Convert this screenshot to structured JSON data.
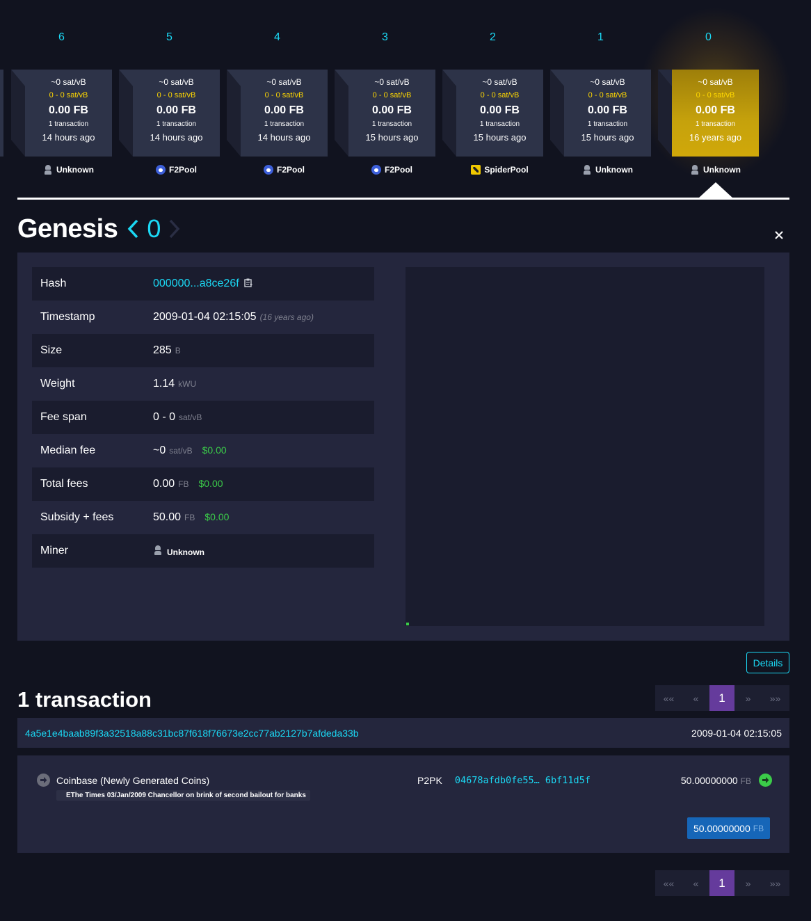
{
  "blocks": [
    {
      "height": "6",
      "median_fee": "~0 sat/vB",
      "fee_span": "0 - 0 sat/vB",
      "total_fees": "0.00 FB",
      "tx_count": "1 transaction",
      "time": "14 hours ago",
      "miner": "Unknown",
      "miner_icon": "unknown-miner-icon",
      "selected": false
    },
    {
      "height": "5",
      "median_fee": "~0 sat/vB",
      "fee_span": "0 - 0 sat/vB",
      "total_fees": "0.00 FB",
      "tx_count": "1 transaction",
      "time": "14 hours ago",
      "miner": "F2Pool",
      "miner_icon": "f2pool-icon",
      "selected": false
    },
    {
      "height": "4",
      "median_fee": "~0 sat/vB",
      "fee_span": "0 - 0 sat/vB",
      "total_fees": "0.00 FB",
      "tx_count": "1 transaction",
      "time": "14 hours ago",
      "miner": "F2Pool",
      "miner_icon": "f2pool-icon",
      "selected": false
    },
    {
      "height": "3",
      "median_fee": "~0 sat/vB",
      "fee_span": "0 - 0 sat/vB",
      "total_fees": "0.00 FB",
      "tx_count": "1 transaction",
      "time": "15 hours ago",
      "miner": "F2Pool",
      "miner_icon": "f2pool-icon",
      "selected": false
    },
    {
      "height": "2",
      "median_fee": "~0 sat/vB",
      "fee_span": "0 - 0 sat/vB",
      "total_fees": "0.00 FB",
      "tx_count": "1 transaction",
      "time": "15 hours ago",
      "miner": "SpiderPool",
      "miner_icon": "spiderpool-icon",
      "selected": false
    },
    {
      "height": "1",
      "median_fee": "~0 sat/vB",
      "fee_span": "0 - 0 sat/vB",
      "total_fees": "0.00 FB",
      "tx_count": "1 transaction",
      "time": "15 hours ago",
      "miner": "Unknown",
      "miner_icon": "unknown-miner-icon",
      "selected": false
    },
    {
      "height": "0",
      "median_fee": "~0 sat/vB",
      "fee_span": "0 - 0 sat/vB",
      "total_fees": "0.00 FB",
      "tx_count": "1 transaction",
      "time": "16 years ago",
      "miner": "Unknown",
      "miner_icon": "unknown-miner-icon",
      "selected": true
    }
  ],
  "colors": {
    "accent": "#1bd8f4",
    "fee_span": "#ffd800",
    "selected_block": "#c6a20c",
    "usd": "#3bcc49",
    "pager_active": "#653b9c",
    "total_badge": "#1666b8"
  },
  "header": {
    "title": "Genesis",
    "height": "0",
    "prev_icon": "chevron-left-icon",
    "next_icon": "chevron-right-icon",
    "close_icon": "close-icon"
  },
  "details": {
    "hash": {
      "label": "Hash",
      "value": "000000...a8ce26f"
    },
    "timestamp": {
      "label": "Timestamp",
      "value": "2009-01-04 02:15:05",
      "ago": "(16 years ago)"
    },
    "size": {
      "label": "Size",
      "value": "285",
      "unit": "B"
    },
    "weight": {
      "label": "Weight",
      "value": "1.14",
      "unit": "kWU"
    },
    "fee_span": {
      "label": "Fee span",
      "value": "0 - 0",
      "unit": "sat/vB"
    },
    "median_fee": {
      "label": "Median fee",
      "value": "~0",
      "unit": "sat/vB",
      "usd": "$0.00"
    },
    "total_fees": {
      "label": "Total fees",
      "value": "0.00",
      "unit": "FB",
      "usd": "$0.00"
    },
    "subsidy_fees": {
      "label": "Subsidy + fees",
      "value": "50.00",
      "unit": "FB",
      "usd": "$0.00"
    },
    "miner": {
      "label": "Miner",
      "value": "Unknown"
    }
  },
  "details_button": "Details",
  "transactions": {
    "heading": "1 transaction",
    "pager": {
      "first": "«« ",
      "prev": "«",
      "current": "1",
      "next": "»",
      "last": "»»"
    },
    "items": [
      {
        "txid": "4a5e1e4baab89f3a32518a88c31bc87f618f76673e2cc77ab2127b7afdeda33b",
        "time": "2009-01-04 02:15:05",
        "input_label": "Coinbase (Newly Generated Coins)",
        "coinbase_message": "EThe Times 03/Jan/2009 Chancellor on brink of second bailout for banks",
        "output_type": "P2PK",
        "output_address": "04678afdb0fe55… 6bf11d5f",
        "output_amount": "50.00000000",
        "output_unit": "FB",
        "total_amount": "50.00000000",
        "total_unit": "FB"
      }
    ]
  }
}
